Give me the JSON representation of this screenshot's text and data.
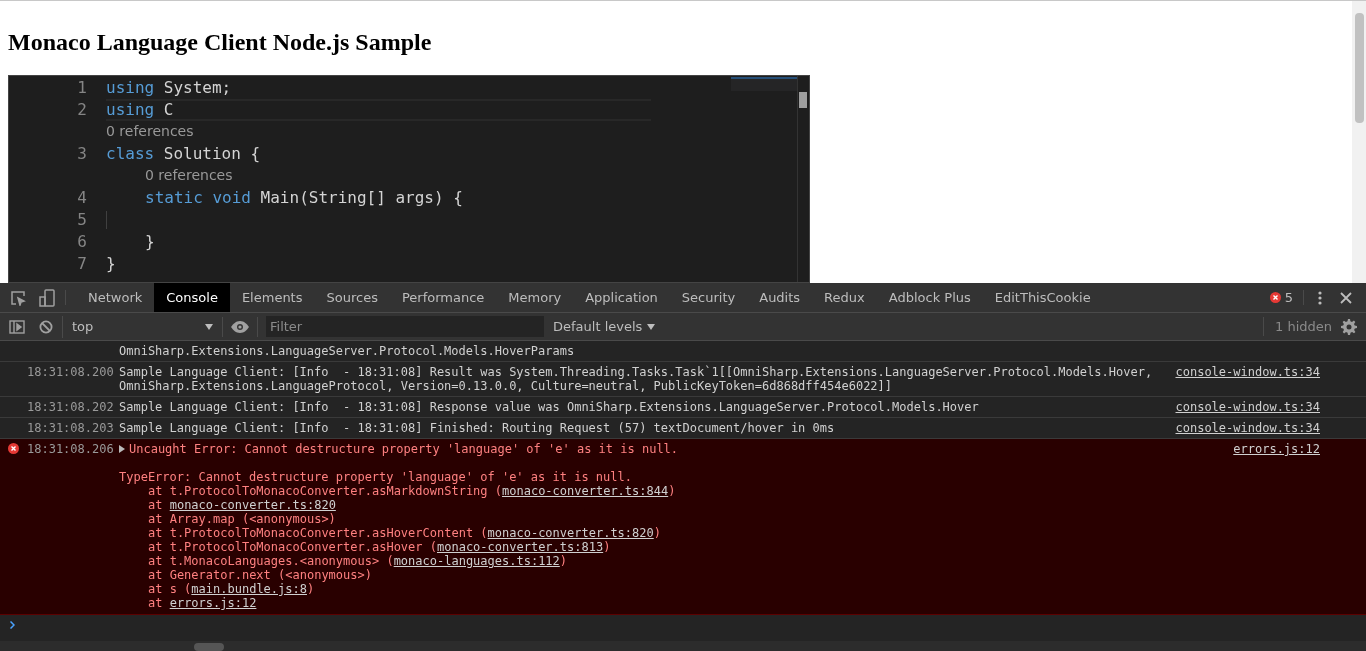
{
  "page": {
    "title": "Monaco Language Client Node.js Sample"
  },
  "editor": {
    "lines": [
      {
        "kind": "code",
        "number": "1",
        "tokens": [
          {
            "kind": "keyword",
            "text": "using"
          },
          {
            "kind": "plain",
            "text": " System;"
          }
        ]
      },
      {
        "kind": "code",
        "number": "2",
        "current": true,
        "tokens": [
          {
            "kind": "keyword",
            "text": "using"
          },
          {
            "kind": "plain",
            "text": " C"
          }
        ]
      },
      {
        "kind": "codelens",
        "text": "0 references"
      },
      {
        "kind": "code",
        "number": "3",
        "tokens": [
          {
            "kind": "keyword",
            "text": "class"
          },
          {
            "kind": "plain",
            "text": " Solution {"
          }
        ],
        "children": [
          {
            "kind": "codelens",
            "text": "0 references"
          },
          {
            "kind": "code",
            "number": "4",
            "tokens": [
              {
                "kind": "keyword",
                "text": "static void"
              },
              {
                "kind": "plain",
                "text": " Main(String[] args) {"
              }
            ]
          },
          {
            "kind": "code",
            "number": "5"
          },
          {
            "kind": "code",
            "number": "6",
            "tokens": [
              {
                "kind": "plain",
                "text": "}"
              }
            ]
          }
        ]
      },
      {
        "kind": "code",
        "number": "7",
        "tokens": [
          {
            "kind": "plain",
            "text": "}"
          }
        ]
      }
    ]
  },
  "devtools": {
    "tabs": [
      {
        "label": "Network",
        "selected": false
      },
      {
        "label": "Console",
        "selected": true
      },
      {
        "label": "Elements",
        "selected": false
      },
      {
        "label": "Sources",
        "selected": false
      },
      {
        "label": "Performance",
        "selected": false
      },
      {
        "label": "Memory",
        "selected": false
      },
      {
        "label": "Application",
        "selected": false
      },
      {
        "label": "Security",
        "selected": false
      },
      {
        "label": "Audits",
        "selected": false
      },
      {
        "label": "Redux",
        "selected": false
      },
      {
        "label": "Adblock Plus",
        "selected": false
      },
      {
        "label": "EditThisCookie",
        "selected": false
      }
    ],
    "error_count": "5",
    "toolbar": {
      "context": "top",
      "filter_placeholder": "Filter",
      "levels": "Default levels",
      "hidden": "1 hidden"
    },
    "messages": [
      {
        "kind": "log",
        "lines": [
          "OmniSharp.Extensions.LanguageServer.Protocol.Models.HoverParams"
        ]
      },
      {
        "kind": "log",
        "time": "18:31:08.200",
        "lines": [
          "Sample Language Client: [Info  - 18:31:08] Result was System.Threading.Tasks.Task`1[[OmniSharp.Extensions.LanguageServer.Protocol.Models.Hover,",
          "OmniSharp.Extensions.LanguageProtocol, Version=0.13.0.0, Culture=neutral, PublicKeyToken=6d868dff454e6022]]"
        ],
        "source": "console-window.ts:34"
      },
      {
        "kind": "log",
        "time": "18:31:08.202",
        "lines": [
          "Sample Language Client: [Info  - 18:31:08] Response value was OmniSharp.Extensions.LanguageServer.Protocol.Models.Hover"
        ],
        "source": "console-window.ts:34"
      },
      {
        "kind": "log",
        "time": "18:31:08.203",
        "lines": [
          "Sample Language Client: [Info  - 18:31:08] Finished: Routing Request (57) textDocument/hover in 0ms"
        ],
        "source": "console-window.ts:34"
      },
      {
        "kind": "error",
        "time": "18:31:08.206",
        "expanded": false,
        "lines": [
          "Uncaught Error: Cannot destructure property 'language' of 'e' as it is null."
        ],
        "source": "errors.js:12",
        "detail": "TypeError: Cannot destructure property 'language' of 'e' as it is null.",
        "stack": [
          {
            "before": "at t.ProtocolToMonacoConverter.asMarkdownString (",
            "link": "monaco-converter.ts:844",
            "after": ")"
          },
          {
            "before": "at ",
            "link": "monaco-converter.ts:820"
          },
          {
            "before": "at Array.map (<anonymous>)"
          },
          {
            "before": "at t.ProtocolToMonacoConverter.asHoverContent (",
            "link": "monaco-converter.ts:820",
            "after": ")"
          },
          {
            "before": "at t.ProtocolToMonacoConverter.asHover (",
            "link": "monaco-converter.ts:813",
            "after": ")"
          },
          {
            "before": "at t.MonacoLanguages.<anonymous> (",
            "link": "monaco-languages.ts:112",
            "after": ")"
          },
          {
            "before": "at Generator.next (<anonymous>)"
          },
          {
            "before": "at s (",
            "link": "main.bundle.js:8",
            "after": ")"
          },
          {
            "before": "at ",
            "link": "errors.js:12"
          }
        ]
      }
    ]
  }
}
